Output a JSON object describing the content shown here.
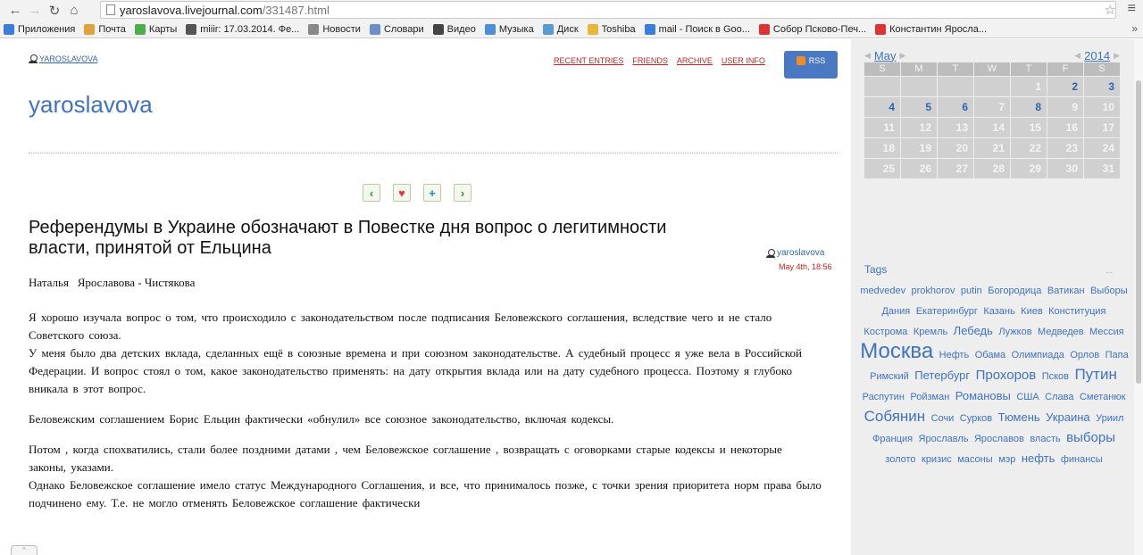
{
  "browser": {
    "url_host": "yaroslavova.livejournal.com",
    "url_path": "/331487.html",
    "bookmarks": [
      {
        "label": "Приложения",
        "color": "#3b7ddd",
        "icon": "grid-icon"
      },
      {
        "label": "Почта",
        "color": "#e2a23a",
        "icon": "mail-icon"
      },
      {
        "label": "Карты",
        "color": "#4cae4c",
        "icon": "map-icon"
      },
      {
        "label": "miiir: 17.03.2014. Фе...",
        "color": "#555555",
        "icon": "user-icon"
      },
      {
        "label": "Новости",
        "color": "#888888",
        "icon": "news-icon"
      },
      {
        "label": "Словари",
        "color": "#6a8fc8",
        "icon": "dict-icon"
      },
      {
        "label": "Видео",
        "color": "#444444",
        "icon": "video-icon"
      },
      {
        "label": "Музыка",
        "color": "#4a90d9",
        "icon": "music-icon"
      },
      {
        "label": "Диск",
        "color": "#5a9bd5",
        "icon": "disk-icon"
      },
      {
        "label": "Toshiba",
        "color": "#e8b73a",
        "icon": "folder-icon"
      },
      {
        "label": "mail - Поиск в Goo...",
        "color": "#3b7ddd",
        "icon": "google-icon"
      },
      {
        "label": "Собор Псково-Печ...",
        "color": "#d33",
        "icon": "yandex-icon"
      },
      {
        "label": "Константин Яросла...",
        "color": "#d33",
        "icon": "yandex-icon"
      }
    ],
    "more": "»"
  },
  "header": {
    "username_small": "YAROSLAVOVA",
    "nav": [
      "RECENT ENTRIES",
      "FRIENDS",
      "ARCHIVE",
      "USER INFO"
    ],
    "rss": "RSS",
    "blog_title": "yaroslavova"
  },
  "post": {
    "title": "Референдумы в Украине обозначают в Повестке дня вопрос о легитимности власти, принятой от Ельцина",
    "user": "yaroslavova",
    "date": "May 4th, 18:56",
    "author": "Наталья   Ярославова - Чистякова",
    "paragraphs": [
      "Я хорошо  изучала  вопрос  о том, что происходило  с   законодательством  после   подписания   Беловежского соглашения, вследствие    чего  и не   стало  Советского  союза.",
      "У  меня  было  два детских  вклада,   сделанных   ещё в союзные времена и   при    союзном  законодательстве.  А  судебный   процесс я уже  вела  в Российской    Федерации. И вопрос  стоял о том, какое законодательство  применять: на дату открытия  вклада или на дату судебного процесса.  Поэтому я     глубоко   вникала  в    этот  вопрос.",
      "Беловежским  соглашением  Борис Ельцин  фактически    «обнулил» все  союзное законодательство, включая            кодексы.",
      "Потом , когда  спохватились, стали более  поздними датами , чем  Беловежское соглашение , возвращать    с оговорками старые   кодексы и некоторые  законы, указами.",
      "Однако        Беловежское  соглашение   имело статус  Международного    Соглашения,  и  все, что принималось позже,    с точки зрения  приоритета норм   права было    подчинено ему.  Т.е.  не могло отменять    Беловежское соглашение        фактически"
    ]
  },
  "calendar": {
    "month": "May",
    "year": "2014",
    "dow": [
      "S",
      "M",
      "T",
      "W",
      "T",
      "F",
      "S"
    ],
    "cells": [
      {
        "d": "",
        "l": false
      },
      {
        "d": "",
        "l": false
      },
      {
        "d": "",
        "l": false
      },
      {
        "d": "",
        "l": false
      },
      {
        "d": "1",
        "l": false
      },
      {
        "d": "2",
        "l": true
      },
      {
        "d": "3",
        "l": true
      },
      {
        "d": "4",
        "l": true
      },
      {
        "d": "5",
        "l": true
      },
      {
        "d": "6",
        "l": true
      },
      {
        "d": "7",
        "l": false
      },
      {
        "d": "8",
        "l": true
      },
      {
        "d": "9",
        "l": false
      },
      {
        "d": "10",
        "l": false
      },
      {
        "d": "11",
        "l": false
      },
      {
        "d": "12",
        "l": false
      },
      {
        "d": "13",
        "l": false
      },
      {
        "d": "14",
        "l": false
      },
      {
        "d": "15",
        "l": false
      },
      {
        "d": "16",
        "l": false
      },
      {
        "d": "17",
        "l": false
      },
      {
        "d": "18",
        "l": false
      },
      {
        "d": "19",
        "l": false
      },
      {
        "d": "20",
        "l": false
      },
      {
        "d": "21",
        "l": false
      },
      {
        "d": "22",
        "l": false
      },
      {
        "d": "23",
        "l": false
      },
      {
        "d": "24",
        "l": false
      },
      {
        "d": "25",
        "l": false
      },
      {
        "d": "26",
        "l": false
      },
      {
        "d": "27",
        "l": false
      },
      {
        "d": "28",
        "l": false
      },
      {
        "d": "29",
        "l": false
      },
      {
        "d": "30",
        "l": false
      },
      {
        "d": "31",
        "l": false
      }
    ]
  },
  "tags": {
    "heading": "Tags",
    "more": "...",
    "items": [
      {
        "t": "medvedev",
        "s": 1
      },
      {
        "t": "prokhorov",
        "s": 1
      },
      {
        "t": "putin",
        "s": 1
      },
      {
        "t": "Богородица",
        "s": 1
      },
      {
        "t": "Ватикан",
        "s": 1
      },
      {
        "t": "Выборы",
        "s": 1
      },
      {
        "t": "Дания",
        "s": 1
      },
      {
        "t": "Екатеринбург",
        "s": 1
      },
      {
        "t": "Казань",
        "s": 1
      },
      {
        "t": "Киев",
        "s": 1
      },
      {
        "t": "Конституция",
        "s": 1
      },
      {
        "t": "Кострома",
        "s": 1
      },
      {
        "t": "Кремль",
        "s": 1
      },
      {
        "t": "Лебедь",
        "s": 2
      },
      {
        "t": "Лужков",
        "s": 1
      },
      {
        "t": "Медведев",
        "s": 1
      },
      {
        "t": "Мессия",
        "s": 1
      },
      {
        "t": "Москва",
        "s": 4
      },
      {
        "t": "Нефть",
        "s": 1
      },
      {
        "t": "Обама",
        "s": 1
      },
      {
        "t": "Олимпиада",
        "s": 1
      },
      {
        "t": "Орлов",
        "s": 1
      },
      {
        "t": "Папа Римский",
        "s": 1
      },
      {
        "t": "Петербург",
        "s": 2
      },
      {
        "t": "Прохоров",
        "s": 3
      },
      {
        "t": "Псков",
        "s": 1
      },
      {
        "t": "Путин",
        "s": 5
      },
      {
        "t": "Распутин",
        "s": 1
      },
      {
        "t": "Ройзман",
        "s": 1
      },
      {
        "t": "Романовы",
        "s": 2
      },
      {
        "t": "США",
        "s": 1
      },
      {
        "t": "Слава",
        "s": 1
      },
      {
        "t": "Сметанюк",
        "s": 1
      },
      {
        "t": "Собянин",
        "s": 5
      },
      {
        "t": "Сочи",
        "s": 1
      },
      {
        "t": "Сурков",
        "s": 1
      },
      {
        "t": "Тюмень",
        "s": 2
      },
      {
        "t": "Украина",
        "s": 2
      },
      {
        "t": "Уриил",
        "s": 1
      },
      {
        "t": "Франция",
        "s": 1
      },
      {
        "t": "Ярославль",
        "s": 1
      },
      {
        "t": "Ярославов",
        "s": 1
      },
      {
        "t": "власть",
        "s": 1
      },
      {
        "t": "выборы",
        "s": 3
      },
      {
        "t": "золото",
        "s": 1
      },
      {
        "t": "кризис",
        "s": 1
      },
      {
        "t": "масоны",
        "s": 1
      },
      {
        "t": "мэр",
        "s": 1
      },
      {
        "t": "нефть",
        "s": 2
      },
      {
        "t": "финансы",
        "s": 1
      }
    ]
  }
}
